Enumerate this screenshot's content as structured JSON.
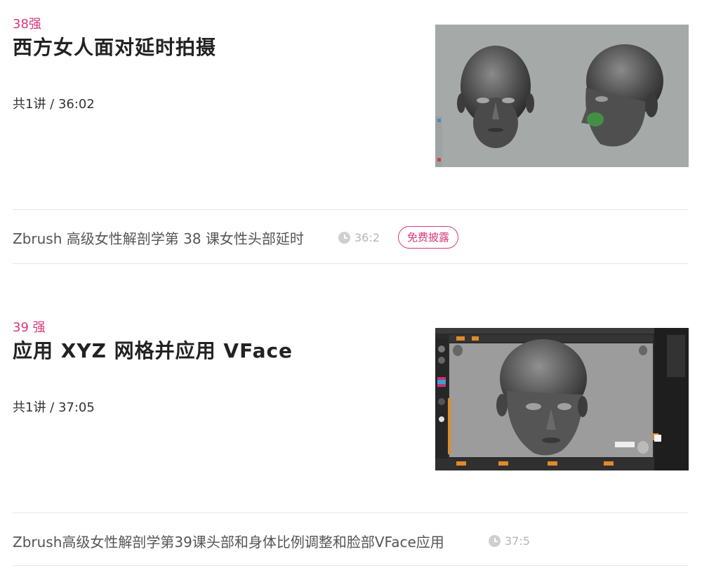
{
  "chapters": [
    {
      "index": "38强",
      "title": "西方女人面对延时拍摄",
      "meta": "共1讲 / 36:02",
      "thumbnail": "zbrush-female-head-front-and-side",
      "lesson": {
        "title": "Zbrush 高级女性解剖学第 38 课女性头部延时",
        "duration": "36:2",
        "badge": "免费披露"
      }
    },
    {
      "index": "39 强",
      "title": "应用 XYZ 网格并应用 VFace",
      "meta": "共1讲 / 37:05",
      "thumbnail": "zbrush-interface-female-head",
      "lesson": {
        "title": "Zbrush高级女性解剖学第39课头部和身体比例调整和脸部VFace应用",
        "duration": "37:5"
      }
    }
  ],
  "colors": {
    "accent": "#d9377a",
    "text": "#333333",
    "muted": "#b5b5b5",
    "divider": "#e6e6e6"
  }
}
